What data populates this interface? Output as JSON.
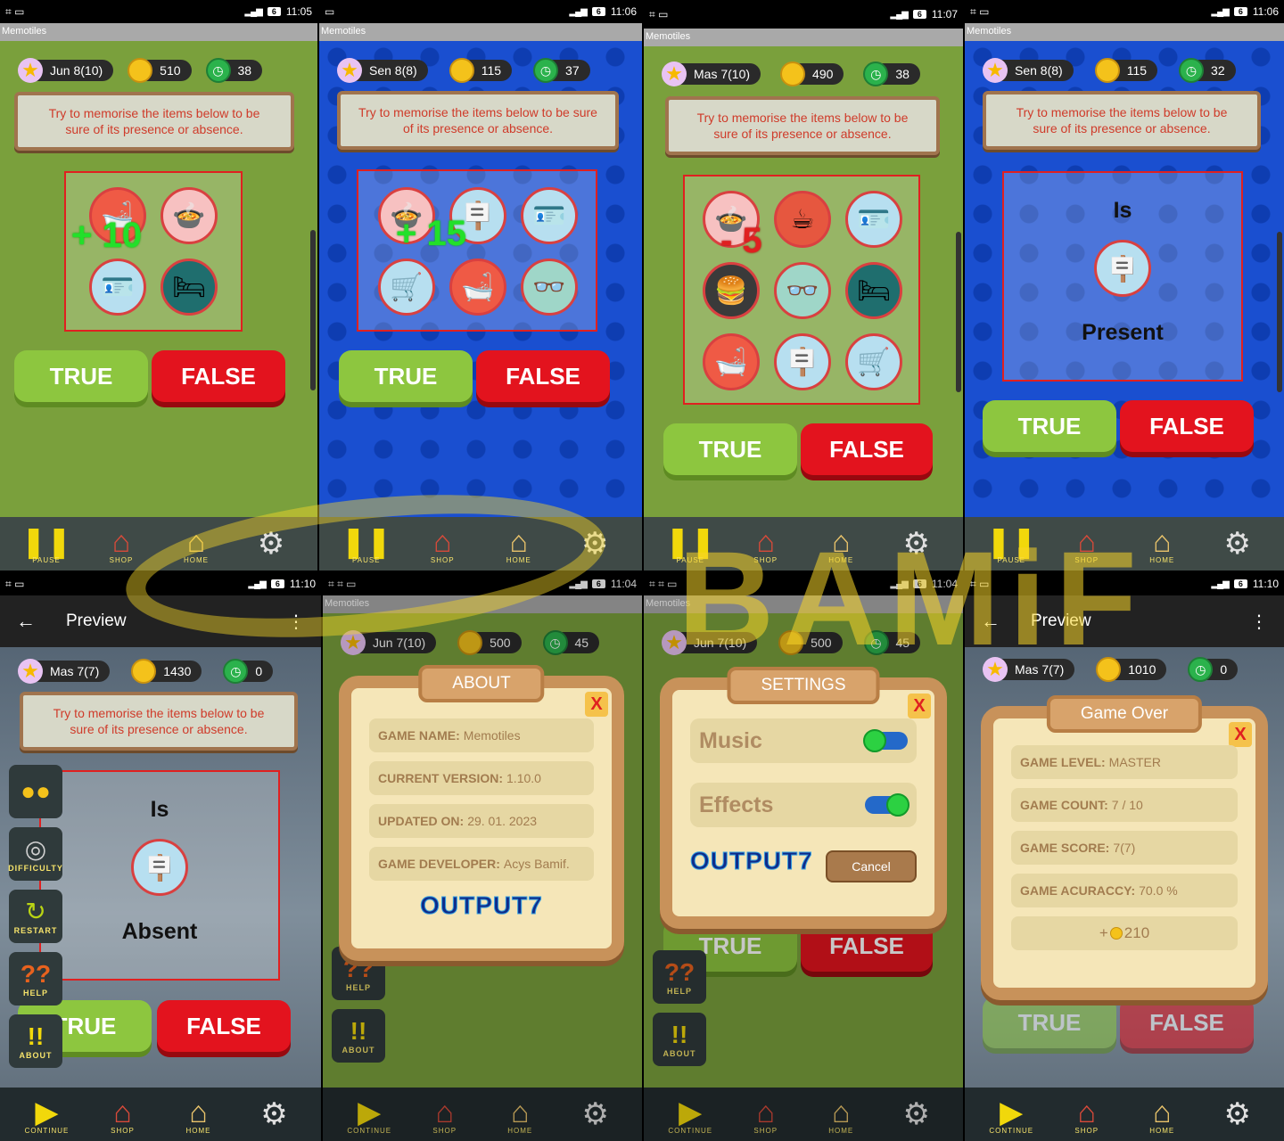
{
  "app_name": "Memotiles",
  "hint_text": "Try to memorise the items below to be sure of its presence or absence.",
  "true_label": "TRUE",
  "false_label": "FALSE",
  "nav": {
    "pause": "PAUSE",
    "home": "HOME",
    "continue": "CONTINUE",
    "shop": "SHOP"
  },
  "side": {
    "difficulty": "DIFFICULTY",
    "restart": "RESTART",
    "help": "HELP",
    "about": "ABOUT",
    "help_glyph": "??",
    "about_glyph": "!!"
  },
  "preview_title": "Preview",
  "question": {
    "is": "Is"
  },
  "watermark": "BAMiF",
  "screens": [
    {
      "time": "11:05",
      "level": "Jun 8(10)",
      "coins": "510",
      "timer": "38",
      "bonus": "+ 10"
    },
    {
      "time": "11:06",
      "level": "Sen 8(8)",
      "coins": "115",
      "timer": "37",
      "bonus": "+ 15"
    },
    {
      "time": "11:07",
      "level": "Mas 7(10)",
      "coins": "490",
      "timer": "38",
      "bonus": "- 5"
    },
    {
      "time": "11:06",
      "level": "Sen 8(8)",
      "coins": "115",
      "timer": "32",
      "answer": "Present"
    },
    {
      "time": "11:10",
      "level": "Mas 7(7)",
      "coins": "1430",
      "timer": "0",
      "answer": "Absent"
    },
    {
      "time": "11:04",
      "level": "Jun 7(10)",
      "coins": "500",
      "timer": "45"
    },
    {
      "time": "11:04",
      "level": "Jun 7(10)",
      "coins": "500",
      "timer": "45"
    },
    {
      "time": "11:10",
      "level": "Mas 7(7)",
      "coins": "1010",
      "timer": "0"
    }
  ],
  "about": {
    "title": "ABOUT",
    "close": "X",
    "rows": [
      {
        "key": "GAME NAME:",
        "value": "Memotiles"
      },
      {
        "key": "CURRENT VERSION:",
        "value": "1.10.0"
      },
      {
        "key": "UPDATED ON:",
        "value": "29. 01. 2023"
      },
      {
        "key": "GAME DEVELOPER:",
        "value": "Acys Bamif."
      }
    ],
    "brand": "OUTPUT7"
  },
  "settings": {
    "title": "SETTINGS",
    "close": "X",
    "music": "Music",
    "effects": "Effects",
    "music_on": false,
    "effects_on": true,
    "brand": "OUTPUT7",
    "cancel": "Cancel"
  },
  "gameover": {
    "title": "Game Over",
    "close": "X",
    "rows": [
      {
        "key": "GAME LEVEL:",
        "value": "MASTER"
      },
      {
        "key": "GAME COUNT:",
        "value": "7 / 10"
      },
      {
        "key": "GAME SCORE:",
        "value": "7(7)"
      },
      {
        "key": "GAME ACURACCY:",
        "value": "70.0 %"
      }
    ],
    "reward": "210"
  },
  "colors": {
    "green_bg": "#7aa03c",
    "blue_bg": "#1a4fd0",
    "true_btn": "#8dc63f",
    "false_btn": "#e3131e",
    "accent_gold": "#f4c21b"
  }
}
